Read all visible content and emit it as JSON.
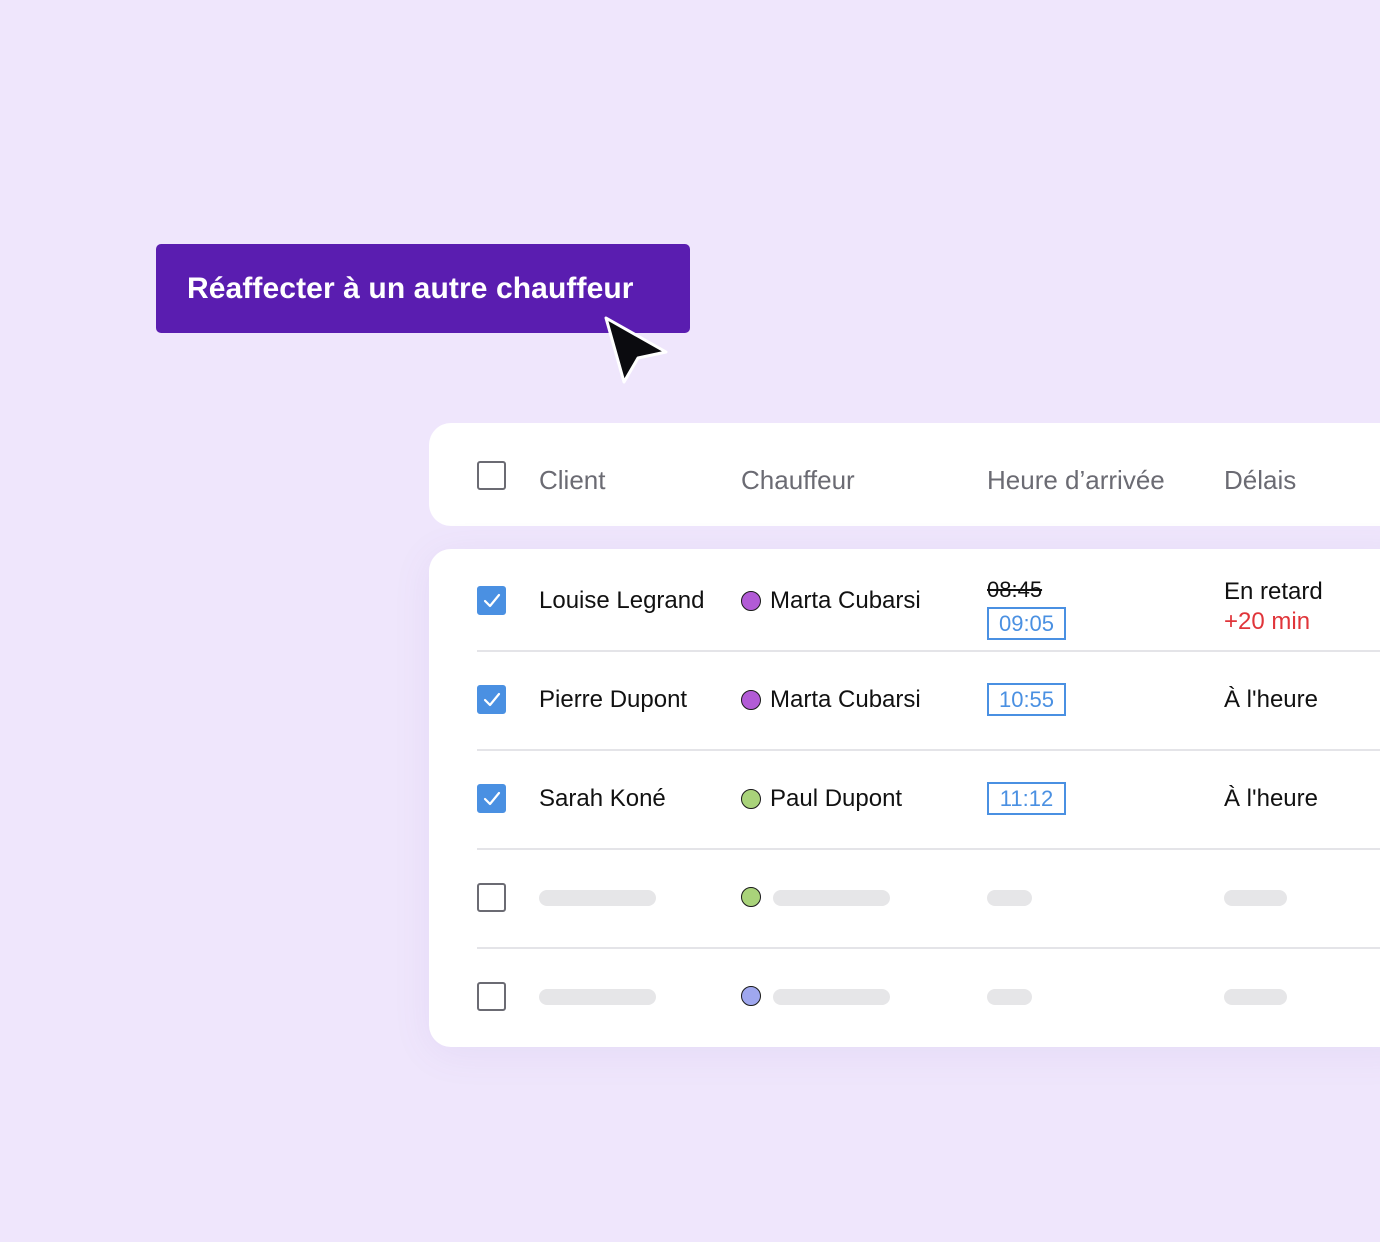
{
  "action": {
    "reassign_label": "Réaffecter à un autre chauffeur"
  },
  "table": {
    "headers": {
      "client": "Client",
      "driver": "Chauffeur",
      "arrival": "Heure d’arrivée",
      "delay": "Délais"
    },
    "rows": [
      {
        "checked": true,
        "client": "Louise Legrand",
        "driver": "Marta Cubarsi",
        "driver_color": "#B25BD6",
        "old_time": "08:45",
        "time": "09:05",
        "status": "En retard",
        "delay": "+20 min"
      },
      {
        "checked": true,
        "client": "Pierre Dupont",
        "driver": "Marta Cubarsi",
        "driver_color": "#B25BD6",
        "time": "10:55",
        "status": "À l'heure"
      },
      {
        "checked": true,
        "client": "Sarah Koné",
        "driver": "Paul Dupont",
        "driver_color": "#A9D37A",
        "time": "11:12",
        "status": "À l'heure"
      },
      {
        "checked": false,
        "placeholder": true,
        "driver_color": "#A9D37A"
      },
      {
        "checked": false,
        "placeholder": true,
        "driver_color": "#9FA7EE"
      }
    ]
  },
  "colors": {
    "background": "#EFE6FC",
    "button": "#5A1DB0",
    "accent_blue": "#4A90E2",
    "late_red": "#E0353A"
  },
  "icons": {
    "cursor": "cursor-arrow-icon",
    "check": "check-icon"
  }
}
